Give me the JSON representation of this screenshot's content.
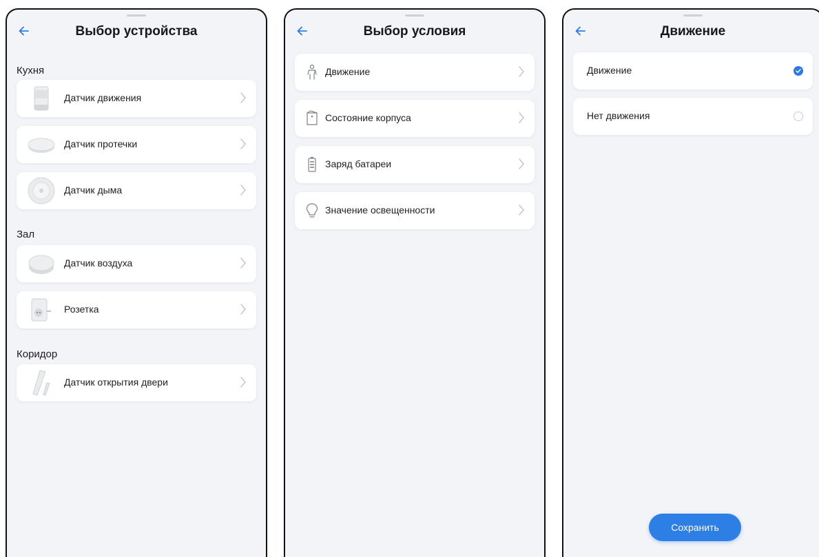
{
  "colors": {
    "accent": "#2b7be6",
    "background": "#f3f4f8",
    "card": "#ffffff"
  },
  "device_screen": {
    "title": "Выбор устройства",
    "sections": [
      {
        "name": "Кухня",
        "devices": [
          {
            "label": "Датчик движения",
            "icon": "motion-sensor-image"
          },
          {
            "label": "Датчик протечки",
            "icon": "leak-sensor-image"
          },
          {
            "label": "Датчик дыма",
            "icon": "smoke-sensor-image"
          }
        ]
      },
      {
        "name": "Зал",
        "devices": [
          {
            "label": "Датчик воздуха",
            "icon": "air-sensor-image"
          },
          {
            "label": "Розетка",
            "icon": "socket-image"
          }
        ]
      },
      {
        "name": "Коридор",
        "devices": [
          {
            "label": "Датчик открытия двери",
            "icon": "door-sensor-image"
          }
        ]
      }
    ]
  },
  "condition_screen": {
    "title": "Выбор условия",
    "conditions": [
      {
        "label": "Движение",
        "icon": "person-icon"
      },
      {
        "label": "Состояние корпуса",
        "icon": "case-icon"
      },
      {
        "label": "Заряд батареи",
        "icon": "battery-icon"
      },
      {
        "label": "Значение освещенности",
        "icon": "lightbulb-icon"
      }
    ]
  },
  "motion_screen": {
    "title": "Движение",
    "options": [
      {
        "label": "Движение",
        "selected": true
      },
      {
        "label": "Нет движения",
        "selected": false
      }
    ],
    "save_label": "Сохранить"
  }
}
